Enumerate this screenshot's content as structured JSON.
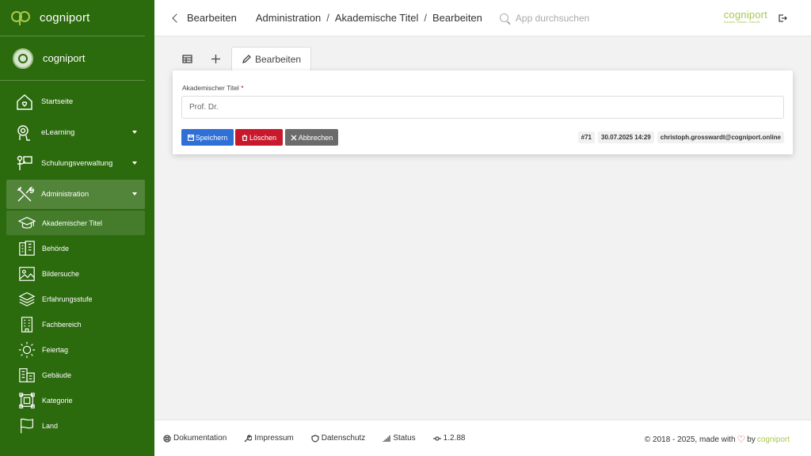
{
  "brand": {
    "name": "cogniport"
  },
  "user": {
    "name": "cogniport"
  },
  "sidebar": {
    "items": [
      {
        "label": "Startseite",
        "icon": "home-icon"
      },
      {
        "label": "eLearning",
        "icon": "elearning-icon"
      },
      {
        "label": "Schulungsverwaltung",
        "icon": "training-icon"
      },
      {
        "label": "Administration",
        "icon": "tools-icon"
      }
    ],
    "sub_items": [
      {
        "label": "Akademischer Titel",
        "icon": "graduation-cap-icon"
      },
      {
        "label": "Behörde",
        "icon": "authority-icon"
      },
      {
        "label": "Bildersuche",
        "icon": "image-icon"
      },
      {
        "label": "Erfahrungsstufe",
        "icon": "layers-icon"
      },
      {
        "label": "Fachbereich",
        "icon": "building-icon"
      },
      {
        "label": "Feiertag",
        "icon": "sun-icon"
      },
      {
        "label": "Gebäude",
        "icon": "buildings-icon"
      },
      {
        "label": "Kategorie",
        "icon": "category-icon"
      },
      {
        "label": "Land",
        "icon": "flag-icon"
      }
    ]
  },
  "header": {
    "back_label": "Bearbeiten",
    "breadcrumb": [
      "Administration",
      "Akademische Titel",
      "Bearbeiten"
    ],
    "search_placeholder": "App durchsuchen",
    "logo_text": "cogniport",
    "logo_tagline": "Schulen. Wissen. Zukunft."
  },
  "tabs": {
    "edit_label": "Bearbeiten"
  },
  "form": {
    "label": "Akademischer Titel",
    "required_mark": "*",
    "value": "Prof. Dr.",
    "save_label": "Speichern",
    "delete_label": "Löschen",
    "cancel_label": "Abbrechen",
    "record_id": "#71",
    "timestamp": "30.07.2025 14:29",
    "author": "christoph.grosswardt@cogniport.online"
  },
  "footer": {
    "links": [
      "Dokumentation",
      "Impressum",
      "Datenschutz",
      "Status",
      "1.2.88"
    ],
    "copyright": "© 2018 - 2025, made with",
    "by": "by",
    "brand": "cogniport"
  },
  "colors": {
    "sidebar": "#2c6a0e",
    "primary": "#2f6fd6",
    "danger": "#c8192c",
    "secondary": "#6b6b6b",
    "brand": "#a8c94a"
  }
}
